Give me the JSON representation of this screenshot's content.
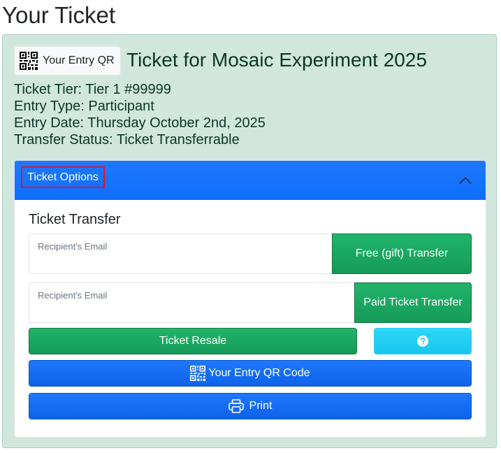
{
  "page": {
    "title": "Your Ticket"
  },
  "ticket": {
    "qr_button_label": "Your Entry QR",
    "title": "Ticket for Mosaic Experiment 2025",
    "tier_line": "Ticket Tier: Tier 1 #99999",
    "entry_type_line": "Entry Type: Participant",
    "entry_date_line": "Entry Date: Thursday October 2nd, 2025",
    "transfer_status_line": "Transfer Status: Ticket Transferrable"
  },
  "options": {
    "header_label": "Ticket Options",
    "expanded": true,
    "section_title": "Ticket Transfer",
    "free_transfer": {
      "email_label": "Recipient's Email",
      "email_value": "",
      "button_label": "Free (gift) Transfer"
    },
    "paid_transfer": {
      "email_label": "Recipient's Email",
      "email_value": "",
      "button_label": "Paid Ticket Transfer"
    },
    "resale_label": "Ticket Resale",
    "help_icon": "question-circle-icon",
    "qr_code_label": "Your Entry QR Code",
    "print_label": "Print"
  },
  "colors": {
    "card_bg": "#d1e7dd",
    "primary": "#0d6efd",
    "success": "#198754",
    "info": "#0dcaf0",
    "highlight": "#e8102e"
  }
}
